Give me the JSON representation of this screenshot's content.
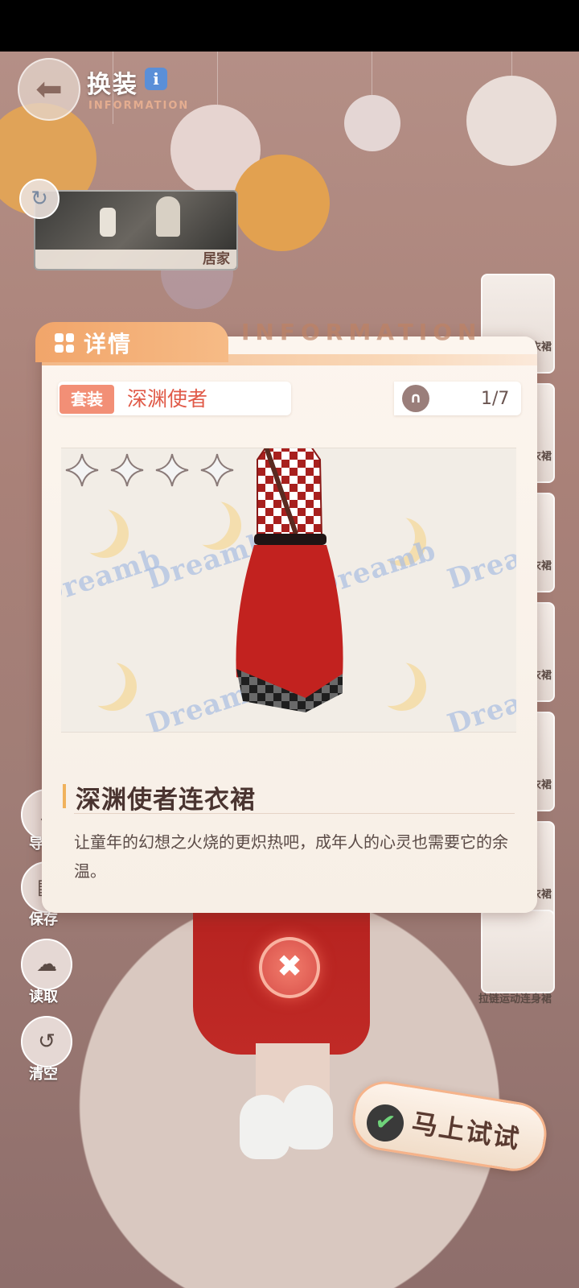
{
  "header": {
    "title": "换装",
    "subtitle": "INFORMATION",
    "info_badge": "i"
  },
  "scene": {
    "label": "居家"
  },
  "side_items": [
    "衣裙",
    "衣裙",
    "衣裙",
    "衣裙",
    "衣裙",
    "衣裙",
    "拉链运动连身裙"
  ],
  "panel": {
    "tab_label": "详情",
    "watermark": "INFORMATION",
    "suit_tag": "套装",
    "suit_name": "深渊使者",
    "count": "1/7",
    "stars": 4,
    "background_logo": "Dreamborn",
    "item_title": "深渊使者连衣裙",
    "item_description": "让童年的幻想之火烧的更炽热吧，成年人的心灵也需要它的余温。"
  },
  "functions": [
    {
      "label": "导",
      "icon": "export-icon"
    },
    {
      "label": "保存",
      "icon": "save-icon"
    },
    {
      "label": "读取",
      "icon": "load-icon"
    },
    {
      "label": "清空",
      "icon": "clear-icon"
    }
  ],
  "try_button": {
    "label": "马上试试"
  },
  "colors": {
    "accent": "#f1a56a",
    "suit_tag": "#f28f76",
    "suit_name": "#e05a48",
    "close": "#d8504a"
  }
}
